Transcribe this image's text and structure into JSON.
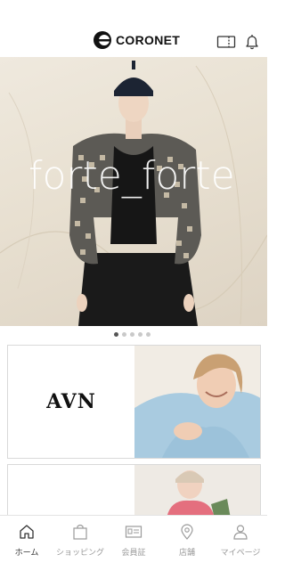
{
  "header": {
    "brand": "CORONET",
    "icons": [
      "coronet-logo-icon",
      "ticket-icon",
      "bell-icon"
    ]
  },
  "hero": {
    "brand_text": "forte_forte",
    "slides_total": 5,
    "active_slide": 1
  },
  "cards": [
    {
      "label": "AVN"
    },
    {
      "label": ""
    }
  ],
  "tabbar": {
    "tabs": [
      {
        "label": "ホーム",
        "icon": "home-icon",
        "active": true
      },
      {
        "label": "ショッピング",
        "icon": "shopping-bag-icon",
        "active": false
      },
      {
        "label": "会員証",
        "icon": "member-card-icon",
        "active": false
      },
      {
        "label": "店舗",
        "icon": "location-pin-icon",
        "active": false
      },
      {
        "label": "マイページ",
        "icon": "person-icon",
        "active": false
      }
    ]
  },
  "colors": {
    "text": "#111111",
    "inactive_tab": "#9a9a9a",
    "active_dot": "#555555",
    "border": "#d9d9d9"
  }
}
